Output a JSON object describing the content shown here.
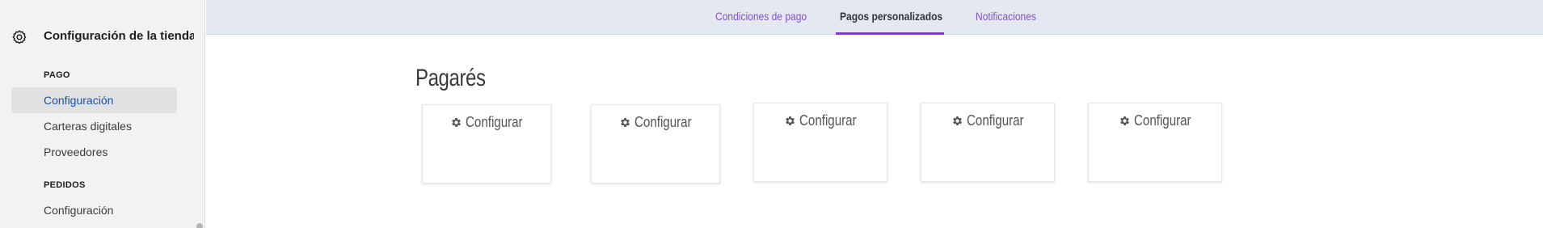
{
  "sidebar": {
    "store_title": "Configuración de la tienda",
    "sections": [
      {
        "heading": "PAGO",
        "items": [
          "Configuración",
          "Carteras digitales",
          "Proveedores"
        ]
      },
      {
        "heading": "PEDIDOS",
        "items": [
          "Configuración"
        ]
      }
    ],
    "active_item": "Configuración"
  },
  "tabs": [
    {
      "label": "Condiciones de pago",
      "active": false
    },
    {
      "label": "Pagos personalizados",
      "active": true
    },
    {
      "label": "Notificaciones",
      "active": false
    }
  ],
  "main": {
    "title": "Pagarés",
    "cards": [
      {
        "button_label": "Configurar",
        "icon": "gear-icon"
      },
      {
        "button_label": "Configurar",
        "icon": "gear-icon"
      },
      {
        "button_label": "Configurar",
        "icon": "gear-icon"
      },
      {
        "button_label": "Configurar",
        "icon": "gear-icon"
      },
      {
        "button_label": "Configurar",
        "icon": "gear-icon"
      }
    ]
  },
  "colors": {
    "accent": "#7b3fc6",
    "tab_link": "#8452c9",
    "active_nav": "#1d4fa8",
    "tabbar_bg": "#e4e9f1",
    "sidebar_bg": "#f2f2f2"
  }
}
